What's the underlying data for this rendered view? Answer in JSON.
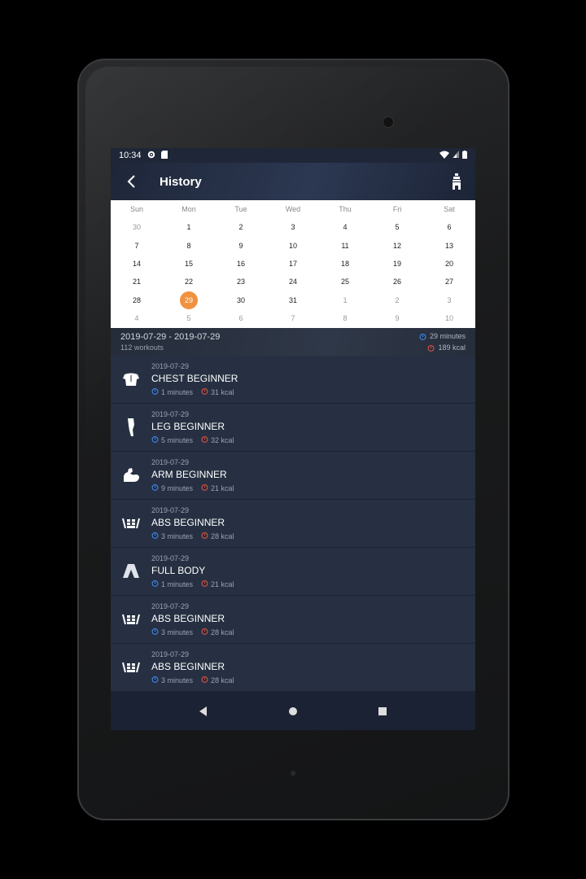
{
  "status": {
    "time": "10:34"
  },
  "appbar": {
    "title": "History"
  },
  "calendar": {
    "weekdays": [
      "Sun",
      "Mon",
      "Tue",
      "Wed",
      "Thu",
      "Fri",
      "Sat"
    ],
    "days": [
      {
        "d": "30",
        "other": true
      },
      {
        "d": "1"
      },
      {
        "d": "2"
      },
      {
        "d": "3"
      },
      {
        "d": "4"
      },
      {
        "d": "5"
      },
      {
        "d": "6"
      },
      {
        "d": "7"
      },
      {
        "d": "8"
      },
      {
        "d": "9"
      },
      {
        "d": "10"
      },
      {
        "d": "11"
      },
      {
        "d": "12"
      },
      {
        "d": "13"
      },
      {
        "d": "14"
      },
      {
        "d": "15"
      },
      {
        "d": "16"
      },
      {
        "d": "17"
      },
      {
        "d": "18"
      },
      {
        "d": "19"
      },
      {
        "d": "20"
      },
      {
        "d": "21"
      },
      {
        "d": "22"
      },
      {
        "d": "23"
      },
      {
        "d": "24"
      },
      {
        "d": "25"
      },
      {
        "d": "26"
      },
      {
        "d": "27"
      },
      {
        "d": "28"
      },
      {
        "d": "29",
        "selected": true
      },
      {
        "d": "30"
      },
      {
        "d": "31"
      },
      {
        "d": "1",
        "other": true
      },
      {
        "d": "2",
        "other": true
      },
      {
        "d": "3",
        "other": true
      },
      {
        "d": "4",
        "other": true
      },
      {
        "d": "5",
        "other": true
      },
      {
        "d": "6",
        "other": true
      },
      {
        "d": "7",
        "other": true
      },
      {
        "d": "8",
        "other": true
      },
      {
        "d": "9",
        "other": true
      },
      {
        "d": "10",
        "other": true
      }
    ],
    "selected_color": "#f0923f"
  },
  "summary": {
    "range": "2019-07-29 - 2019-07-29",
    "count": "112 workouts",
    "minutes": "29 minutes",
    "kcal": "189 kcal"
  },
  "workouts": [
    {
      "date": "2019-07-29",
      "name": "CHEST BEGINNER",
      "minutes": "1 minutes",
      "kcal": "31 kcal",
      "icon": "chest-icon"
    },
    {
      "date": "2019-07-29",
      "name": "LEG BEGINNER",
      "minutes": "5 minutes",
      "kcal": "32 kcal",
      "icon": "leg-icon"
    },
    {
      "date": "2019-07-29",
      "name": "ARM BEGINNER",
      "minutes": "9 minutes",
      "kcal": "21 kcal",
      "icon": "arm-icon"
    },
    {
      "date": "2019-07-29",
      "name": "ABS BEGINNER",
      "minutes": "3 minutes",
      "kcal": "28 kcal",
      "icon": "abs-icon"
    },
    {
      "date": "2019-07-29",
      "name": "FULL BODY",
      "minutes": "1 minutes",
      "kcal": "21 kcal",
      "icon": "full-body-icon"
    },
    {
      "date": "2019-07-29",
      "name": "ABS BEGINNER",
      "minutes": "3 minutes",
      "kcal": "28 kcal",
      "icon": "abs-icon"
    },
    {
      "date": "2019-07-29",
      "name": "ABS BEGINNER",
      "minutes": "3 minutes",
      "kcal": "28 kcal",
      "icon": "abs-icon"
    }
  ],
  "colors": {
    "timer_blue": "#3d8bf0",
    "kcal_red": "#e0513f"
  }
}
